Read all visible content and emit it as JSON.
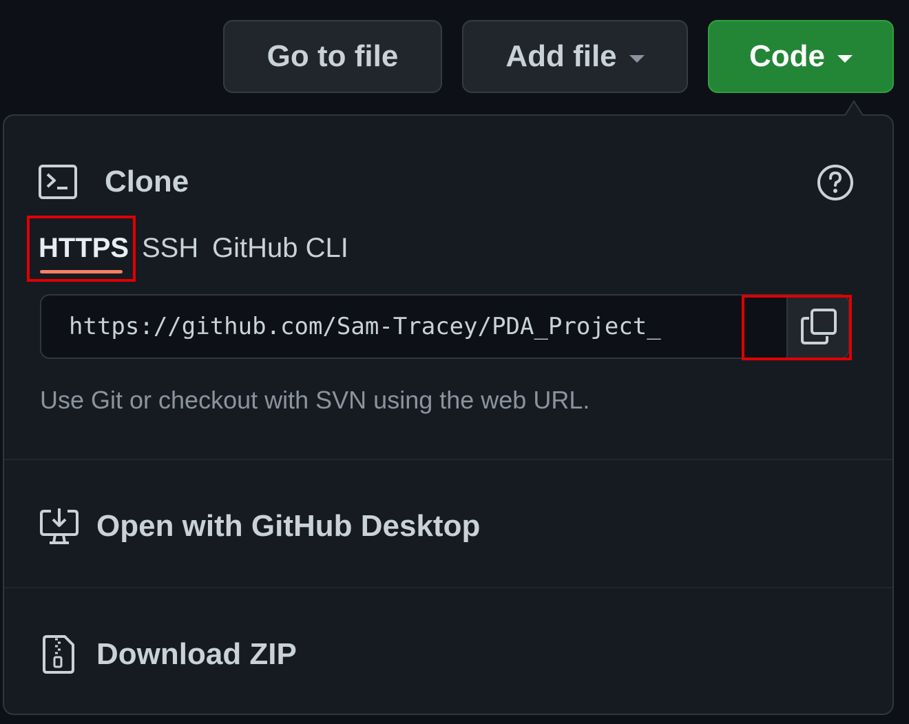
{
  "toolbar": {
    "go_to_file_label": "Go to file",
    "add_file_label": "Add file",
    "code_label": "Code"
  },
  "clone": {
    "title": "Clone",
    "help_icon": "question-circle-icon",
    "tabs": [
      {
        "label": "HTTPS",
        "selected": true
      },
      {
        "label": "SSH",
        "selected": false
      },
      {
        "label": "GitHub CLI",
        "selected": false
      }
    ],
    "url_value": "https://github.com/Sam-Tracey/PDA_Project_",
    "copy_icon": "copy-icon",
    "hint": "Use Git or checkout with SVN using the web URL."
  },
  "menu": {
    "open_desktop_label": "Open with GitHub Desktop",
    "download_zip_label": "Download ZIP"
  },
  "colors": {
    "background": "#0d1117",
    "panel": "#161b22",
    "code_button": "#238636",
    "tab_underline": "#f78166",
    "highlight_box": "#e00000"
  }
}
